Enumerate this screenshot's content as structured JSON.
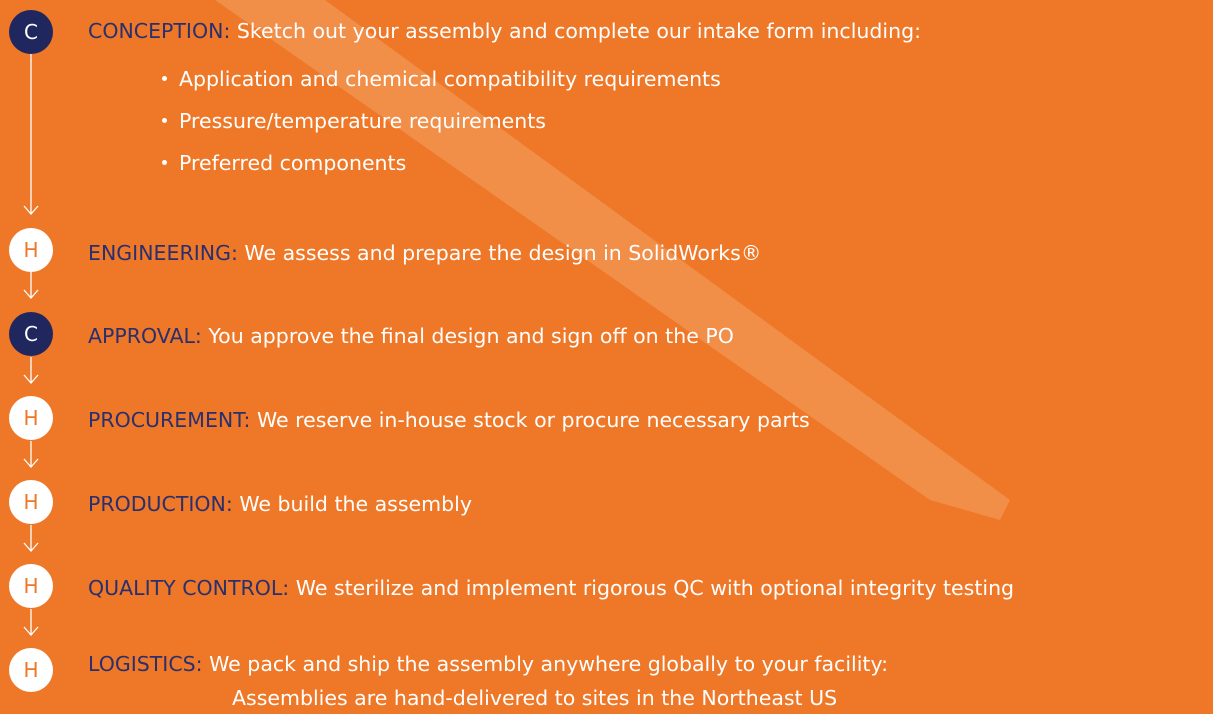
{
  "colors": {
    "background": "#EE7828",
    "client_badge": "#20275E",
    "heat_badge_text": "#EE7828",
    "keyword": "#2A2F6E",
    "text": "#FFFFFF"
  },
  "steps": [
    {
      "badge": "C",
      "key": "CONCEPTION:",
      "desc": "Sketch out your assembly and complete our intake form including:"
    },
    {
      "badge": "H",
      "key": "ENGINEERING:",
      "desc": "We assess and prepare the design in SolidWorks®"
    },
    {
      "badge": "C",
      "key": "APPROVAL:",
      "desc": "You approve the final design and sign off on the PO"
    },
    {
      "badge": "H",
      "key": "PROCUREMENT:",
      "desc": "We reserve in-house stock or procure necessary parts"
    },
    {
      "badge": "H",
      "key": "PRODUCTION:",
      "desc": "We build the assembly"
    },
    {
      "badge": "H",
      "key": "QUALITY CONTROL:",
      "desc": "We sterilize and implement rigorous QC with optional integrity testing"
    },
    {
      "badge": "H",
      "key": "LOGISTICS:",
      "desc": "We pack and ship the assembly anywhere globally to your facility:"
    }
  ],
  "conception_bullets": [
    "Application and chemical compatibility requirements",
    "Pressure/temperature requirements",
    "Preferred components"
  ],
  "logistics_note": "Assemblies are hand-delivered to sites in the Northeast US"
}
